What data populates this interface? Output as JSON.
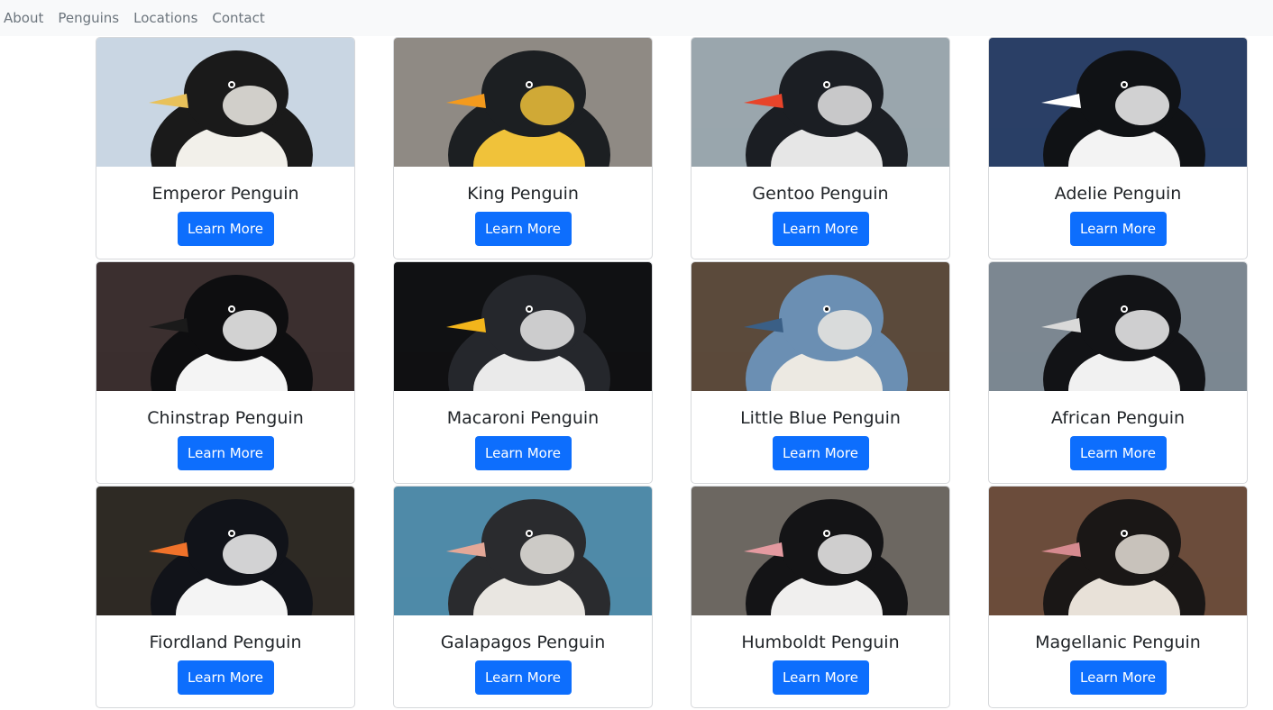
{
  "nav": {
    "items": [
      "About",
      "Penguins",
      "Locations",
      "Contact"
    ]
  },
  "button_label": "Learn More",
  "colors": {
    "primary": "#0d6efd",
    "navbar_bg": "#f8f9fa",
    "nav_text": "#6c757d"
  },
  "penguins": [
    {
      "name": "Emperor Penguin",
      "bg": "#c9d6e3",
      "body": "#1a1a1a",
      "belly": "#f2f0ea",
      "accent": "#e8c15a"
    },
    {
      "name": "King Penguin",
      "bg": "#8f8a84",
      "body": "#1c1f22",
      "belly": "#f0c23a",
      "accent": "#f39a1d"
    },
    {
      "name": "Gentoo Penguin",
      "bg": "#9aa6ad",
      "body": "#1b1e23",
      "belly": "#e6e6e6",
      "accent": "#e8442a"
    },
    {
      "name": "Adelie Penguin",
      "bg": "#2a3f66",
      "body": "#101215",
      "belly": "#f3f3f3",
      "accent": "#ffffff"
    },
    {
      "name": "Chinstrap Penguin",
      "bg": "#3b2f2f",
      "body": "#0e0e10",
      "belly": "#f4f4f4",
      "accent": "#1a1a1a"
    },
    {
      "name": "Macaroni Penguin",
      "bg": "#101113",
      "body": "#25272c",
      "belly": "#eaeaea",
      "accent": "#f3b51b"
    },
    {
      "name": "Little Blue Penguin",
      "bg": "#5b4a3b",
      "body": "#6b8fb3",
      "belly": "#ece9e2",
      "accent": "#3a5f86"
    },
    {
      "name": "African Penguin",
      "bg": "#7c8791",
      "body": "#121316",
      "belly": "#f1f1f1",
      "accent": "#d9d9d9"
    },
    {
      "name": "Fiordland Penguin",
      "bg": "#2e2a24",
      "body": "#111319",
      "belly": "#f4f4f4",
      "accent": "#f0722a"
    },
    {
      "name": "Galapagos Penguin",
      "bg": "#4f8aa8",
      "body": "#2a2b2e",
      "belly": "#e9e6e1",
      "accent": "#e3a898"
    },
    {
      "name": "Humboldt Penguin",
      "bg": "#6c6761",
      "body": "#141416",
      "belly": "#f0efee",
      "accent": "#e49aa0"
    },
    {
      "name": "Magellanic Penguin",
      "bg": "#6b4c3b",
      "body": "#1a1716",
      "belly": "#e8e1d8",
      "accent": "#d68a8f"
    }
  ]
}
